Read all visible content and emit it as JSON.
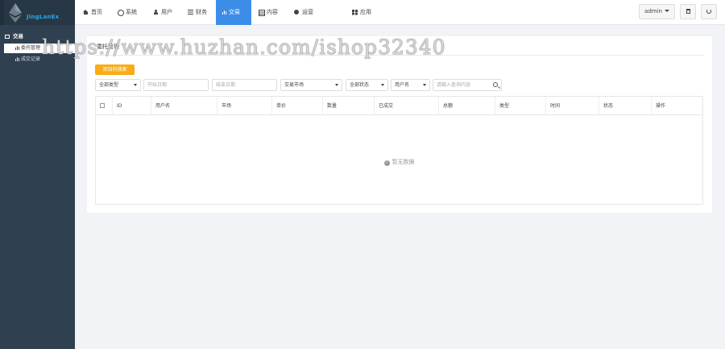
{
  "brand": {
    "name": "JingLanEx"
  },
  "sidebar": {
    "section_label": "交易",
    "items": [
      {
        "label": "委托管理",
        "active": true
      },
      {
        "label": "成交记录",
        "active": false
      }
    ]
  },
  "nav": {
    "items": [
      {
        "label": "首页",
        "icon": "home-icon"
      },
      {
        "label": "系统",
        "icon": "gear-icon"
      },
      {
        "label": "用户",
        "icon": "user-icon"
      },
      {
        "label": "财务",
        "icon": "list-icon"
      },
      {
        "label": "交易",
        "icon": "bar-chart-icon",
        "active": true
      },
      {
        "label": "内容",
        "icon": "document-icon"
      },
      {
        "label": "运营",
        "icon": "globe-icon"
      },
      {
        "label": "应用",
        "icon": "grid-icon"
      }
    ],
    "user_label": "admin",
    "active_color": "#3c8de8"
  },
  "panel": {
    "title": "委托管理",
    "add_button": "添加的搜索",
    "add_button_color": "#f8ac17"
  },
  "filters": {
    "type_select": "全部类型",
    "start_date_placeholder": "开始日期",
    "end_date_placeholder": "结束日期",
    "market_select": "交易市场",
    "status_select": "全部状态",
    "user_select": "用户名",
    "search_placeholder": "请输入查询内容"
  },
  "table": {
    "columns": [
      "ID",
      "用户名",
      "市场",
      "单价",
      "数量",
      "已成交",
      "总额",
      "类型",
      "时间",
      "状态",
      "操作"
    ],
    "empty_text": "暂无数据"
  },
  "watermark": "https://www.huzhan.com/ishop32340"
}
